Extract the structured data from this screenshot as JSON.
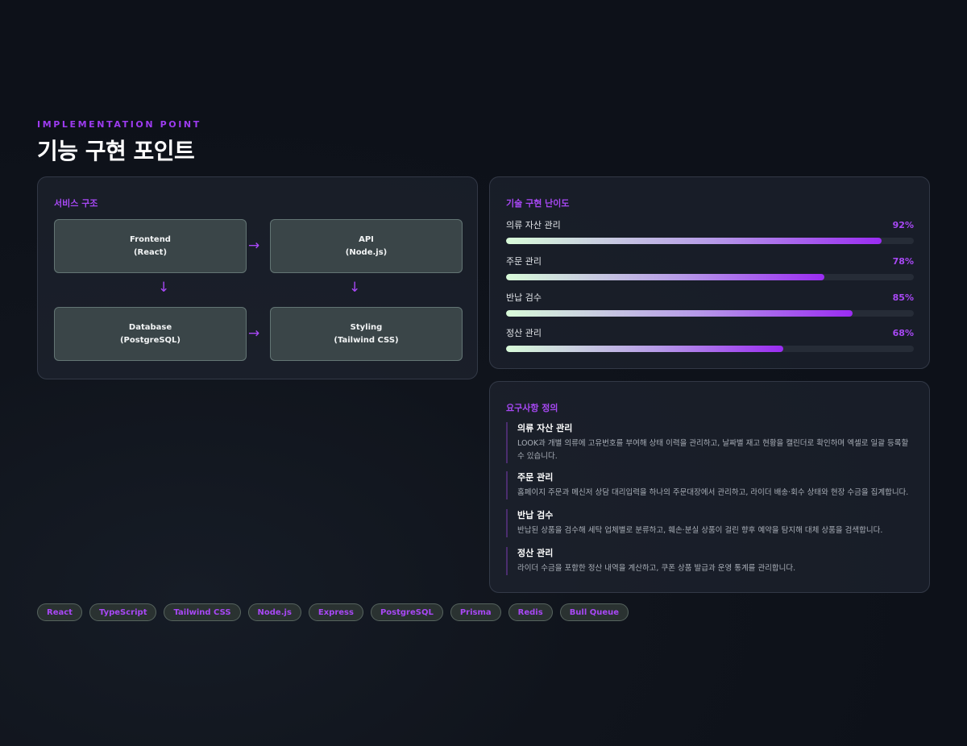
{
  "header": {
    "eyebrow": "IMPLEMENTATION POINT",
    "title": "기능 구현 포인트"
  },
  "structure": {
    "label": "서비스 구조",
    "nodes": [
      {
        "name": "Frontend",
        "tech": "(React)"
      },
      {
        "name": "API",
        "tech": "(Node.js)"
      },
      {
        "name": "Database",
        "tech": "(PostgreSQL)"
      },
      {
        "name": "Styling",
        "tech": "(Tailwind CSS)"
      }
    ],
    "arrow_right": "→",
    "arrow_down": "↓"
  },
  "difficulty": {
    "label": "기술 구현 난이도",
    "items": [
      {
        "name": "의류 자산 관리",
        "percent": 92,
        "percent_label": "92%"
      },
      {
        "name": "주문 관리",
        "percent": 78,
        "percent_label": "78%"
      },
      {
        "name": "반납 검수",
        "percent": 85,
        "percent_label": "85%"
      },
      {
        "name": "정산 관리",
        "percent": 68,
        "percent_label": "68%"
      }
    ]
  },
  "requirements": {
    "label": "요구사항 정의",
    "items": [
      {
        "title": "의류 자산 관리",
        "desc": "LOOK과 개별 의류에 고유번호를 부여해 상태 이력을 관리하고, 날짜별 재고 현황을 캘린더로 확인하며 엑셀로 일괄 등록할 수 있습니다."
      },
      {
        "title": "주문 관리",
        "desc": "홈페이지 주문과 메신저 상담 대리입력을 하나의 주문대장에서 관리하고, 라이더 배송·회수 상태와 현장 수금을 집계합니다."
      },
      {
        "title": "반납 검수",
        "desc": "반납된 상품을 검수해 세탁 업체별로 분류하고, 훼손·분실 상품이 걸린 향후 예약을 탐지해 대체 상품을 검색합니다."
      },
      {
        "title": "정산 관리",
        "desc": "라이더 수금을 포함한 정산 내역을 계산하고, 쿠폰 상품 발급과 운영 통계를 관리합니다."
      }
    ]
  },
  "tags": [
    "React",
    "TypeScript",
    "Tailwind CSS",
    "Node.js",
    "Express",
    "PostgreSQL",
    "Prisma",
    "Redis",
    "Bull Queue"
  ],
  "colors": {
    "accent": "#a848f5",
    "background": "#10141c",
    "node_fill": "#3a4548",
    "bar_start": "#d9fbd9",
    "bar_end": "#9a2cf2"
  }
}
